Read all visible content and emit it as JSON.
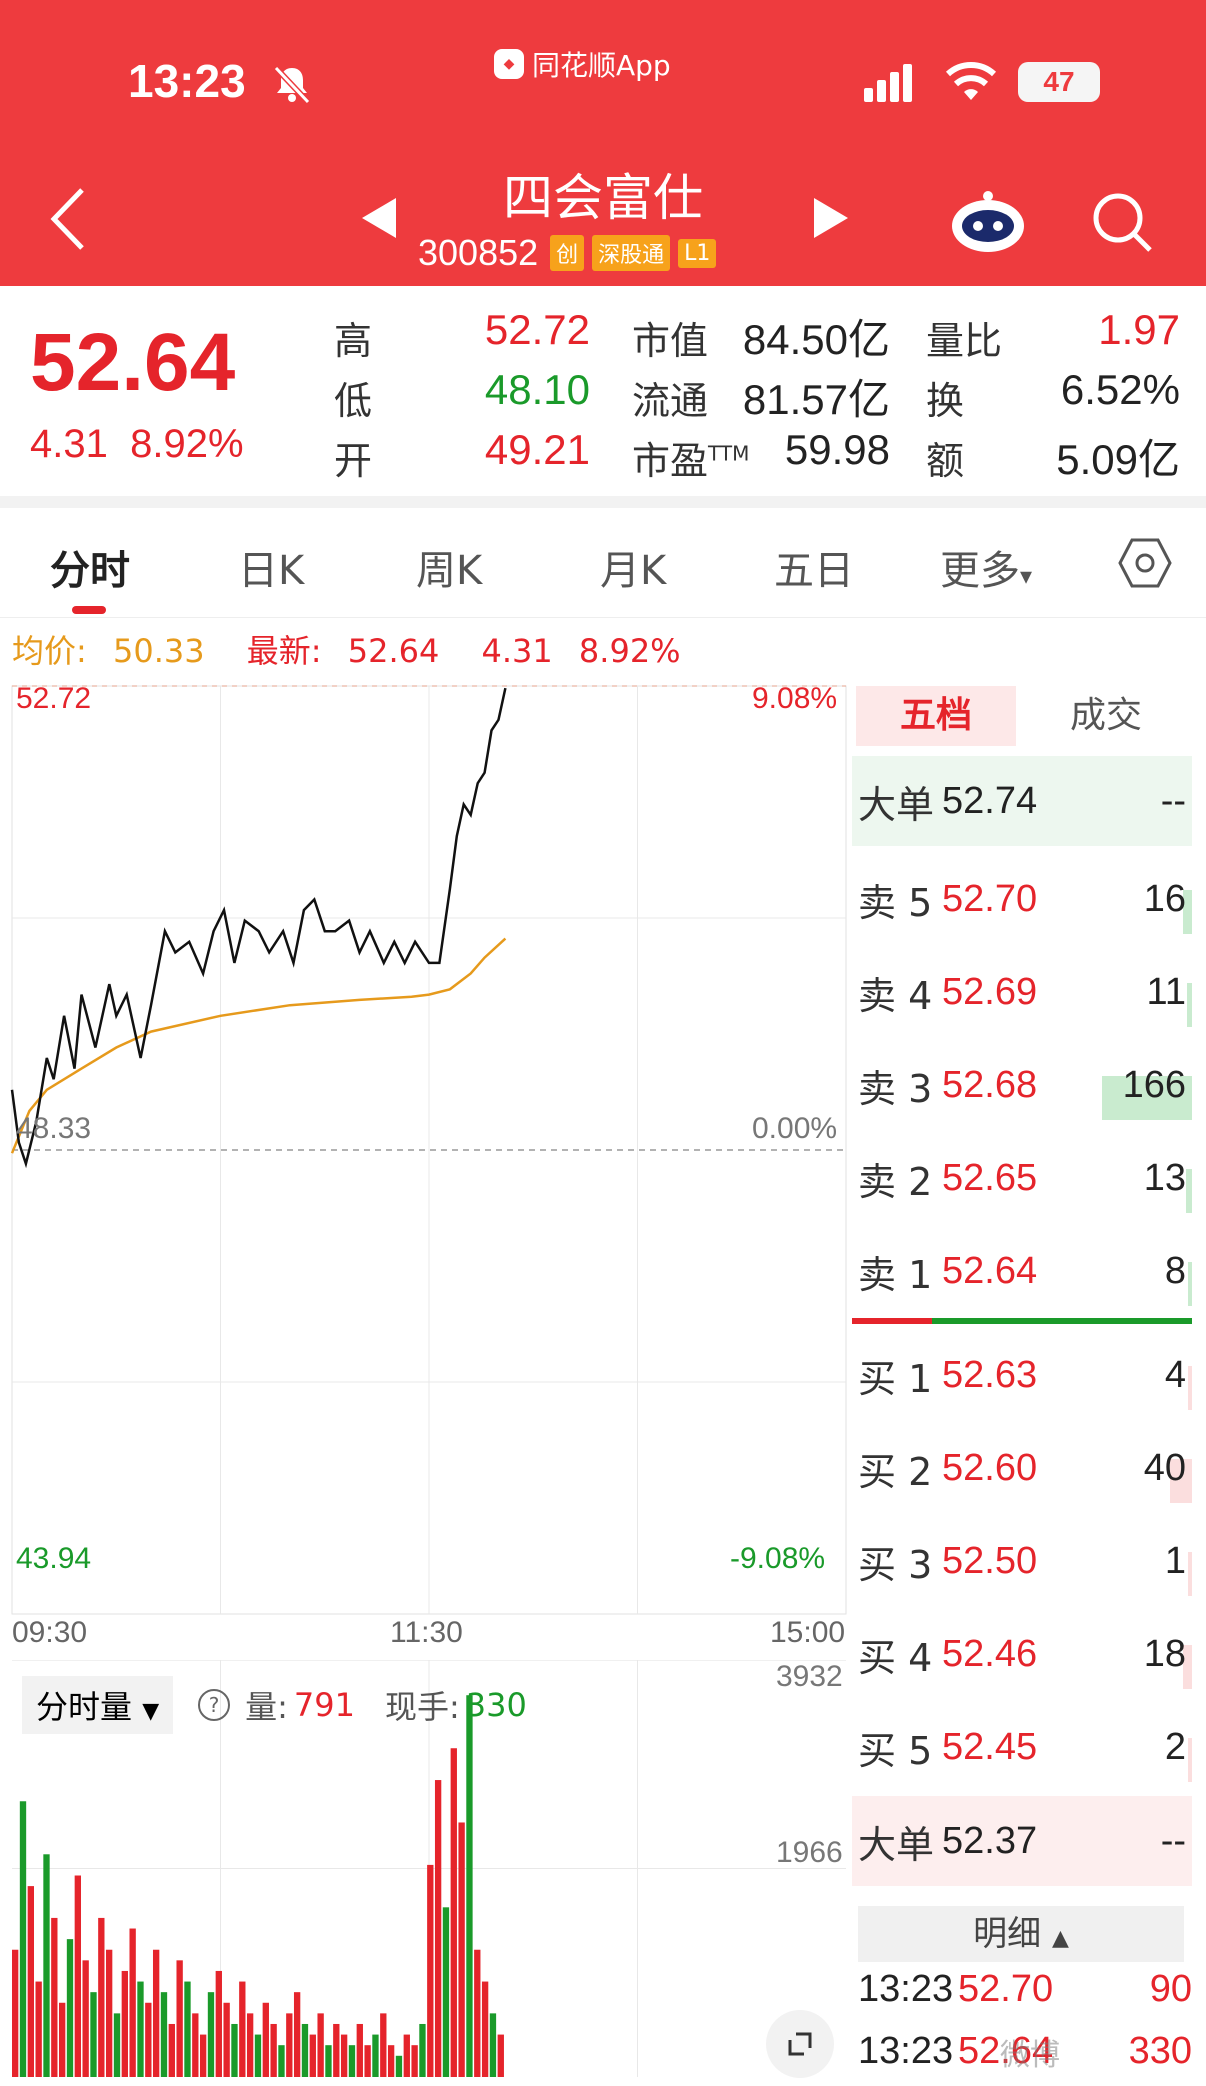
{
  "status": {
    "time": "13:23",
    "app": "同花顺App",
    "battery": "47"
  },
  "header": {
    "stock_name": "四会富仕",
    "stock_code": "300852",
    "tags": [
      "创",
      "深股通",
      "L1"
    ]
  },
  "quote": {
    "price": "52.64",
    "change": "4.31",
    "change_pct": "8.92%",
    "rows": [
      {
        "l1": "高",
        "v1": "52.72",
        "l2": "市值",
        "v2": "84.50亿",
        "l3": "量比",
        "v3": "1.97"
      },
      {
        "l1": "低",
        "v1": "48.10",
        "l2": "流通",
        "v2": "81.57亿",
        "l3": "换",
        "v3": "6.52%"
      },
      {
        "l1": "开",
        "v1": "49.21",
        "l2": "市盈",
        "l2sup": "TTM",
        "v2": "59.98",
        "l3": "额",
        "v3": "5.09亿"
      }
    ]
  },
  "tabs": [
    "分时",
    "日K",
    "周K",
    "月K",
    "五日",
    "更多"
  ],
  "legend": {
    "avg_label": "均价:",
    "avg_value": "50.33",
    "latest_label": "最新:",
    "latest_value": "52.64",
    "latest_change": "4.31",
    "latest_pct": "8.92%"
  },
  "chart_axis": {
    "top_price": "52.72",
    "top_pct": "9.08%",
    "mid_price": "48.33",
    "mid_pct": "0.00%",
    "bot_price": "43.94",
    "bot_pct": "-9.08%",
    "time_start": "09:30",
    "time_mid": "11:30",
    "time_end": "15:00"
  },
  "volume_panel": {
    "dropdown": "分时量",
    "vol_label": "量:",
    "vol_value": "791",
    "hand_label": "现手:",
    "hand_value": "330",
    "max": "3932",
    "mid": "1966"
  },
  "orderbook": {
    "tab_active": "五档",
    "tab_other": "成交",
    "big_sell": {
      "label": "大单",
      "price": "52.74",
      "vol": "--"
    },
    "sells": [
      {
        "label": "卖 5",
        "price": "52.70",
        "vol": "16",
        "bar": 0.1
      },
      {
        "label": "卖 4",
        "price": "52.69",
        "vol": "11",
        "bar": 0.06
      },
      {
        "label": "卖 3",
        "price": "52.68",
        "vol": "166",
        "bar": 1.0
      },
      {
        "label": "卖 2",
        "price": "52.65",
        "vol": "13",
        "bar": 0.07
      },
      {
        "label": "卖 1",
        "price": "52.64",
        "vol": "8",
        "bar": 0.05
      }
    ],
    "buys": [
      {
        "label": "买 1",
        "price": "52.63",
        "vol": "4",
        "bar": 0.03
      },
      {
        "label": "买 2",
        "price": "52.60",
        "vol": "40",
        "bar": 0.24
      },
      {
        "label": "买 3",
        "price": "52.50",
        "vol": "1",
        "bar": 0.01
      },
      {
        "label": "买 4",
        "price": "52.46",
        "vol": "18",
        "bar": 0.1
      },
      {
        "label": "买 5",
        "price": "52.45",
        "vol": "2",
        "bar": 0.01
      }
    ],
    "big_buy": {
      "label": "大单",
      "price": "52.37",
      "vol": "--"
    },
    "detail_label": "明细",
    "ticks": [
      {
        "time": "13:23",
        "price": "52.70",
        "vol": "90"
      },
      {
        "time": "13:23",
        "price": "52.64",
        "vol": "330"
      }
    ]
  },
  "chart_data": {
    "type": "line",
    "price_range": [
      43.94,
      52.72
    ],
    "prev_close": 48.33,
    "x_range_minutes": [
      0,
      240
    ],
    "x_ticks": [
      "09:30",
      "11:30",
      "15:00"
    ],
    "price_series": [
      [
        0,
        48.9
      ],
      [
        2,
        48.4
      ],
      [
        4,
        48.2
      ],
      [
        7,
        48.6
      ],
      [
        10,
        49.2
      ],
      [
        12,
        49.0
      ],
      [
        15,
        49.6
      ],
      [
        18,
        49.1
      ],
      [
        20,
        49.8
      ],
      [
        24,
        49.3
      ],
      [
        28,
        49.9
      ],
      [
        30,
        49.6
      ],
      [
        33,
        49.8
      ],
      [
        37,
        49.2
      ],
      [
        40,
        49.7
      ],
      [
        44,
        50.4
      ],
      [
        47,
        50.2
      ],
      [
        51,
        50.3
      ],
      [
        55,
        50.0
      ],
      [
        58,
        50.4
      ],
      [
        61,
        50.6
      ],
      [
        64,
        50.1
      ],
      [
        67,
        50.5
      ],
      [
        71,
        50.4
      ],
      [
        74,
        50.2
      ],
      [
        78,
        50.4
      ],
      [
        81,
        50.1
      ],
      [
        84,
        50.6
      ],
      [
        87,
        50.7
      ],
      [
        90,
        50.4
      ],
      [
        93,
        50.4
      ],
      [
        97,
        50.5
      ],
      [
        100,
        50.2
      ],
      [
        103,
        50.4
      ],
      [
        107,
        50.1
      ],
      [
        110,
        50.3
      ],
      [
        113,
        50.1
      ],
      [
        116,
        50.3
      ],
      [
        120,
        50.1
      ],
      [
        123,
        50.1
      ],
      [
        126,
        50.8
      ],
      [
        128,
        51.3
      ],
      [
        130,
        51.6
      ],
      [
        132,
        51.5
      ],
      [
        134,
        51.8
      ],
      [
        136,
        51.9
      ],
      [
        138,
        52.3
      ],
      [
        140,
        52.4
      ],
      [
        142,
        52.7
      ]
    ],
    "avg_series": [
      [
        0,
        48.3
      ],
      [
        5,
        48.7
      ],
      [
        10,
        48.9
      ],
      [
        20,
        49.1
      ],
      [
        30,
        49.3
      ],
      [
        40,
        49.45
      ],
      [
        60,
        49.6
      ],
      [
        80,
        49.7
      ],
      [
        100,
        49.75
      ],
      [
        115,
        49.78
      ],
      [
        120,
        49.8
      ],
      [
        126,
        49.85
      ],
      [
        132,
        50.0
      ],
      [
        136,
        50.15
      ],
      [
        142,
        50.33
      ]
    ],
    "volume_series": [
      1200,
      2600,
      1800,
      900,
      2100,
      1500,
      700,
      1300,
      1900,
      1100,
      800,
      1500,
      1200,
      600,
      1000,
      1400,
      900,
      700,
      1200,
      800,
      500,
      1100,
      900,
      600,
      400,
      800,
      1000,
      700,
      500,
      900,
      600,
      400,
      700,
      500,
      300,
      600,
      800,
      500,
      400,
      600,
      300,
      500,
      400,
      300,
      500,
      300,
      400,
      600,
      300,
      200,
      400,
      300,
      500,
      2000,
      2800,
      1600,
      3100,
      2400,
      3600,
      1200,
      900,
      600,
      400
    ],
    "volume_max": 3932
  }
}
